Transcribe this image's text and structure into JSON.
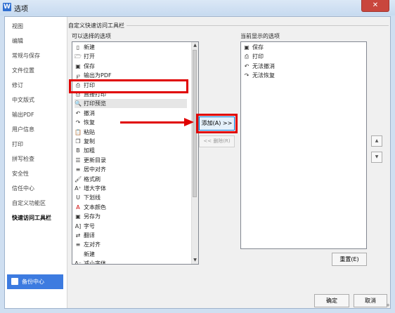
{
  "window": {
    "title": "选项",
    "app_icon": "W"
  },
  "nav": {
    "items": [
      "视图",
      "编辑",
      "常规与保存",
      "文件位置",
      "修订",
      "中文版式",
      "输出PDF",
      "用户信息",
      "打印",
      "拼写检查",
      "安全性",
      "信任中心",
      "自定义功能区",
      "快速访问工具栏"
    ],
    "active_index": 13,
    "backup_label": "备份中心"
  },
  "group": {
    "label": "自定义快速访问工具栏"
  },
  "available": {
    "label": "可以选择的选项",
    "items": [
      {
        "icon": "new-doc-icon",
        "glyph": "▯",
        "label": "新建"
      },
      {
        "icon": "open-folder-icon",
        "glyph": "🗁",
        "label": "打开"
      },
      {
        "icon": "save-icon",
        "glyph": "▣",
        "label": "保存"
      },
      {
        "icon": "export-pdf-icon",
        "glyph": "℘",
        "label": "输出为PDF"
      },
      {
        "icon": "print-icon",
        "glyph": "⎙",
        "label": "打印"
      },
      {
        "icon": "direct-print-icon",
        "glyph": "⎙",
        "label": "直接打印"
      },
      {
        "icon": "print-preview-icon",
        "glyph": "🔍",
        "label": "打印预览"
      },
      {
        "icon": "undo-icon",
        "glyph": "↶",
        "label": "撤消"
      },
      {
        "icon": "redo-icon",
        "glyph": "↷",
        "label": "恢复"
      },
      {
        "icon": "paste-icon",
        "glyph": "📋",
        "label": "粘贴"
      },
      {
        "icon": "copy-icon",
        "glyph": "❐",
        "label": "复制"
      },
      {
        "icon": "bold-icon",
        "glyph": "B",
        "label": "加粗"
      },
      {
        "icon": "update-toc-icon",
        "glyph": "☰",
        "label": "更新目录"
      },
      {
        "icon": "align-center-icon",
        "glyph": "≡",
        "label": "居中对齐"
      },
      {
        "icon": "format-painter-icon",
        "glyph": "🖌",
        "label": "格式刷"
      },
      {
        "icon": "grow-font-icon",
        "glyph": "A⁺",
        "label": "增大字体"
      },
      {
        "icon": "underline-icon",
        "glyph": "U",
        "label": "下划线"
      },
      {
        "icon": "font-color-icon",
        "glyph": "A",
        "label": "文本颜色"
      },
      {
        "icon": "save-as-icon",
        "glyph": "▣",
        "label": "另存为"
      },
      {
        "icon": "font-size-icon",
        "glyph": "A]",
        "label": "字号"
      },
      {
        "icon": "translate-icon",
        "glyph": "⇄",
        "label": "翻译"
      },
      {
        "icon": "align-left-icon",
        "glyph": "≡",
        "label": "左对齐"
      },
      {
        "icon": "new-icon",
        "glyph": "",
        "label": "新建"
      },
      {
        "icon": "shrink-font-icon",
        "glyph": "A⁻",
        "label": "减小字体"
      }
    ],
    "selected_index": 6
  },
  "current": {
    "label": "当前显示的选项",
    "items": [
      {
        "icon": "save-icon",
        "glyph": "▣",
        "label": "保存"
      },
      {
        "icon": "print-icon",
        "glyph": "⎙",
        "label": "打印"
      },
      {
        "icon": "undo-icon",
        "glyph": "↶",
        "label": "无法撤消"
      },
      {
        "icon": "redo-icon",
        "glyph": "↷",
        "label": "无法恢复"
      }
    ]
  },
  "buttons": {
    "add": "添加(A) >>",
    "remove": "<< 删除(R)",
    "reset": "重置(E)",
    "ok": "确定",
    "cancel": "取消"
  },
  "colors": {
    "accent": "#3d7be0",
    "annotation": "#e00000",
    "title_bar": "#c7daf0"
  }
}
